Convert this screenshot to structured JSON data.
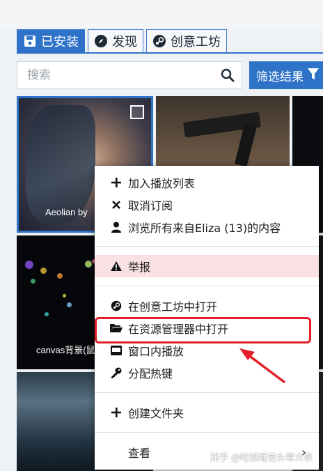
{
  "tabs": [
    {
      "label": "已安装",
      "icon": "save-icon",
      "active": true
    },
    {
      "label": "发现",
      "icon": "compass-icon",
      "active": false
    },
    {
      "label": "创意工坊",
      "icon": "steam-icon",
      "active": false
    }
  ],
  "search": {
    "placeholder": "搜索",
    "value": ""
  },
  "filter": {
    "label": "筛选结果"
  },
  "thumbnails": [
    {
      "caption": "Aeolian by"
    },
    {
      "caption": "canvas背景(鼠"
    }
  ],
  "context_menu": {
    "items": [
      {
        "label": "加入播放列表",
        "icon": "plus-icon"
      },
      {
        "label": "取消订阅",
        "icon": "close-icon"
      },
      {
        "label": "浏览所有来自Eliza (13)的内容",
        "icon": "user-icon"
      },
      {
        "label": "举报",
        "icon": "warning-icon"
      },
      {
        "label": "在创意工坊中打开",
        "icon": "steam-icon"
      },
      {
        "label": "在资源管理器中打开",
        "icon": "folder-open-icon"
      },
      {
        "label": "窗口内播放",
        "icon": "window-icon"
      },
      {
        "label": "分配热键",
        "icon": "key-icon"
      },
      {
        "label": "创建文件夹",
        "icon": "plus-icon"
      },
      {
        "label": "查看",
        "icon": "chevron-right-icon"
      }
    ]
  },
  "annotation": {
    "highlight_color": "#e3202a"
  },
  "watermark": "知乎 @吃饭睡觉头等大事",
  "colors": {
    "accent": "#2f73c8",
    "report_bg": "#f9e1e3"
  }
}
